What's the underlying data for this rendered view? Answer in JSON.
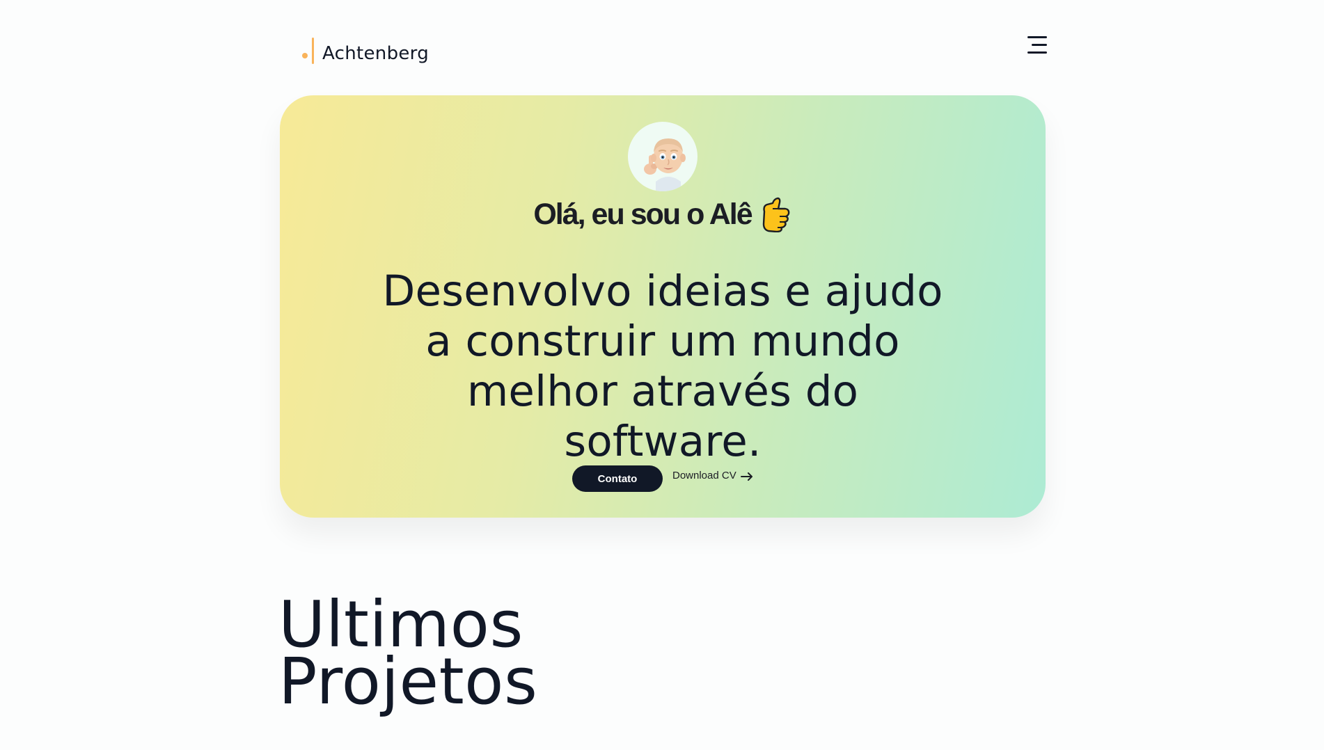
{
  "header": {
    "brand": "Achtenberg",
    "brand_accent": "#f9b35a",
    "menu_icon": "hamburger-menu-icon"
  },
  "hero": {
    "avatar_icon": "memoji-avatar-icon",
    "greeting": "Olá, eu sou o Alê",
    "greeting_emoji": "thumbs-up-emoji-icon",
    "headline": "Desenvolvo ideias e ajudo a construir um mundo melhor através do software.",
    "primary_button": "Contato",
    "secondary_link": "Download CV",
    "secondary_icon": "arrow-right-icon",
    "gradient_start": "#f7ea97",
    "gradient_end": "#adebd4"
  },
  "projects": {
    "title_line1": "Ultimos",
    "title_line2": "Projetos"
  }
}
